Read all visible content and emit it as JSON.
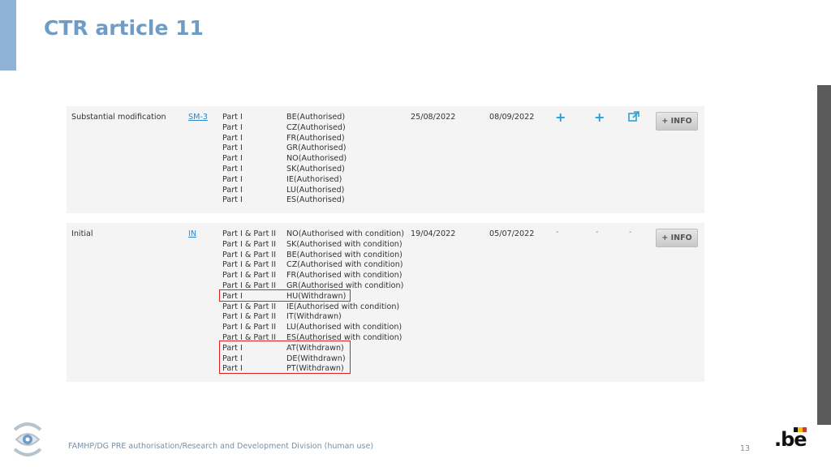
{
  "slide": {
    "title": "CTR article 11",
    "footer": "FAMHP/DG PRE authorisation/Research and Development Division (human use)",
    "page_number": "13",
    "logo_text": ".be",
    "accent_color": "#8fb3d6",
    "title_color": "#6f9cc6",
    "highlight_color": "#e02020"
  },
  "rows": [
    {
      "type": "Substantial modification",
      "link": "SM-3",
      "parts": [
        "Part I",
        "Part I",
        "Part I",
        "Part I",
        "Part I",
        "Part I",
        "Part I",
        "Part I",
        "Part I"
      ],
      "statuses": [
        "BE(Authorised)",
        "CZ(Authorised)",
        "FR(Authorised)",
        "GR(Authorised)",
        "NO(Authorised)",
        "SK(Authorised)",
        "IE(Authorised)",
        "LU(Authorised)",
        "ES(Authorised)"
      ],
      "date1": "25/08/2022",
      "date2": "08/09/2022",
      "actions": [
        "plus-icon",
        "plus-icon",
        "external-link-icon"
      ],
      "info_label": "+ INFO"
    },
    {
      "type": "Initial",
      "link": "IN",
      "parts": [
        "Part I & Part II",
        "Part I & Part II",
        "Part I & Part II",
        "Part I & Part II",
        "Part I & Part II",
        "Part I & Part II",
        "Part I",
        "Part I & Part II",
        "Part I & Part II",
        "Part I & Part II",
        "Part I & Part II",
        "Part I",
        "Part I",
        "Part I"
      ],
      "statuses": [
        "NO(Authorised with condition)",
        "SK(Authorised with condition)",
        "BE(Authorised with condition)",
        "CZ(Authorised with condition)",
        "FR(Authorised with condition)",
        "GR(Authorised with condition)",
        "HU(Withdrawn)",
        "IE(Authorised with condition)",
        "IT(Withdrawn)",
        "LU(Authorised with condition)",
        "ES(Authorised with condition)",
        "AT(Withdrawn)",
        "DE(Withdrawn)",
        "PT(Withdrawn)"
      ],
      "date1": "19/04/2022",
      "date2": "05/07/2022",
      "dashes": [
        "-",
        "-",
        "-"
      ],
      "info_label": "+ INFO"
    }
  ]
}
